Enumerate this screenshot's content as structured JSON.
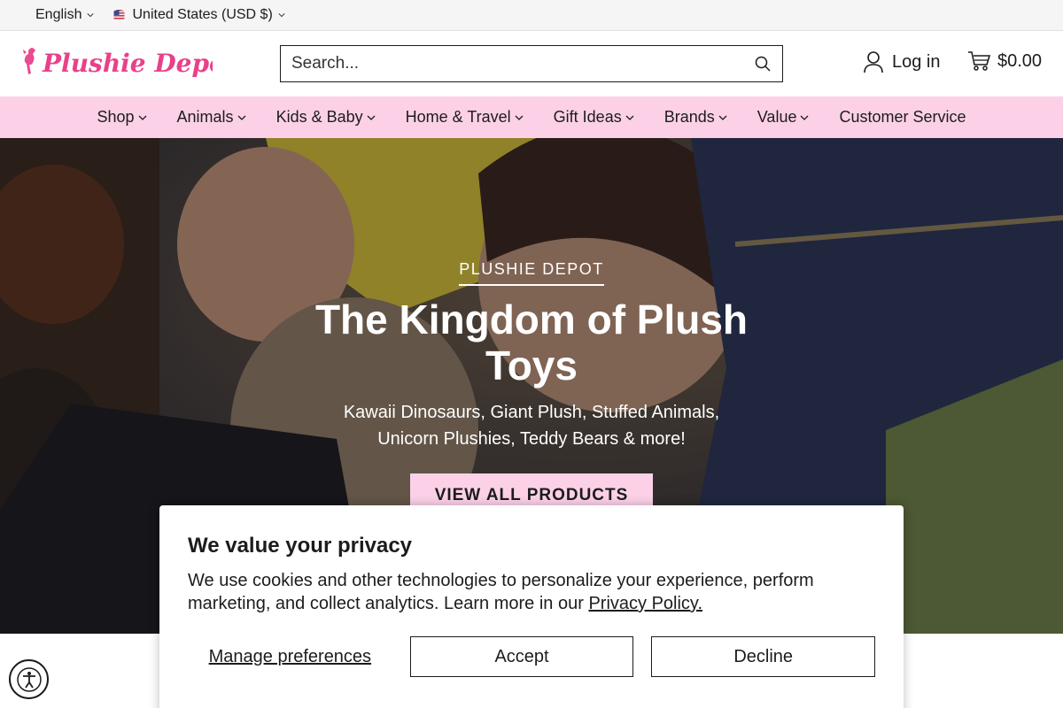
{
  "util_bar": {
    "language": "English",
    "region": "United States (USD $)"
  },
  "header": {
    "logo_text": "Plushie Depot",
    "search_placeholder": "Search...",
    "login_label": "Log in",
    "cart_total": "$0.00"
  },
  "nav": {
    "items": [
      {
        "label": "Shop"
      },
      {
        "label": "Animals"
      },
      {
        "label": "Kids & Baby"
      },
      {
        "label": "Home & Travel"
      },
      {
        "label": "Gift Ideas"
      },
      {
        "label": "Brands"
      },
      {
        "label": "Value"
      },
      {
        "label": "Customer Service"
      }
    ]
  },
  "hero": {
    "eyebrow": "PLUSHIE DEPOT",
    "title_line1": "The Kingdom of Plush",
    "title_line2": "Toys",
    "subtitle_line1": "Kawaii Dinosaurs, Giant Plush, Stuffed Animals,",
    "subtitle_line2": "Unicorn Plushies, Teddy Bears & more!",
    "button_label": "VIEW ALL PRODUCTS"
  },
  "cookie": {
    "title": "We value your privacy",
    "text": "We use cookies and other technologies to personalize your experience, perform marketing, and collect analytics. Learn more in our",
    "link_label": "Privacy Policy.",
    "manage_label": "Manage preferences",
    "accept_label": "Accept",
    "decline_label": "Decline"
  },
  "colors": {
    "accent_pink": "#fcd1e8",
    "logo_pink": "#e8418a",
    "text": "#1c1c1c"
  },
  "icons": [
    "flag-us-icon",
    "search-icon",
    "user-icon",
    "cart-icon",
    "chevron-down-icon",
    "accessibility-icon"
  ]
}
